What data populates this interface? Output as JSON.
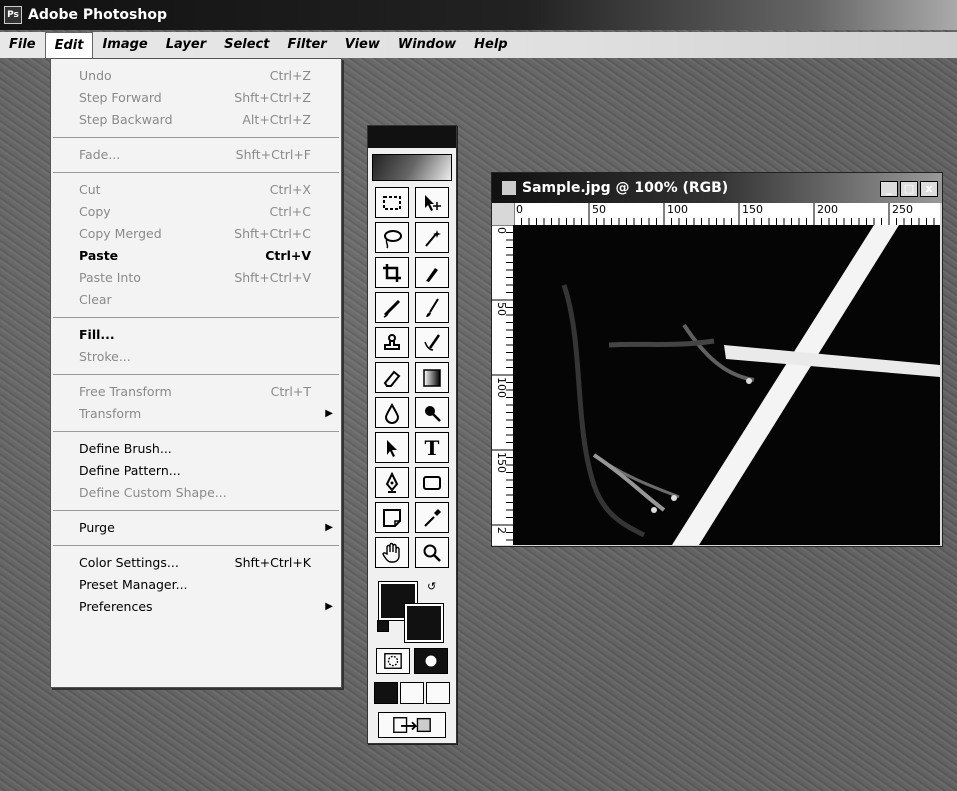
{
  "app": {
    "title": "Adobe Photoshop"
  },
  "menubar": {
    "items": [
      {
        "label": "File"
      },
      {
        "label": "Edit"
      },
      {
        "label": "Image"
      },
      {
        "label": "Layer"
      },
      {
        "label": "Select"
      },
      {
        "label": "Filter"
      },
      {
        "label": "View"
      },
      {
        "label": "Window"
      },
      {
        "label": "Help"
      }
    ],
    "active": "Edit"
  },
  "edit_menu": {
    "undo": {
      "label": "Undo",
      "shortcut": "Ctrl+Z"
    },
    "step_forward": {
      "label": "Step Forward",
      "shortcut": "Shft+Ctrl+Z"
    },
    "step_backward": {
      "label": "Step Backward",
      "shortcut": "Alt+Ctrl+Z"
    },
    "fade": {
      "label": "Fade...",
      "shortcut": "Shft+Ctrl+F"
    },
    "cut": {
      "label": "Cut",
      "shortcut": "Ctrl+X"
    },
    "copy": {
      "label": "Copy",
      "shortcut": "Ctrl+C"
    },
    "copy_merged": {
      "label": "Copy Merged",
      "shortcut": "Shft+Ctrl+C"
    },
    "paste": {
      "label": "Paste",
      "shortcut": "Ctrl+V"
    },
    "paste_into": {
      "label": "Paste Into",
      "shortcut": "Shft+Ctrl+V"
    },
    "clear": {
      "label": "Clear"
    },
    "fill": {
      "label": "Fill..."
    },
    "stroke": {
      "label": "Stroke..."
    },
    "free_transform": {
      "label": "Free Transform",
      "shortcut": "Ctrl+T"
    },
    "transform": {
      "label": "Transform"
    },
    "define_brush": {
      "label": "Define Brush..."
    },
    "define_pattern": {
      "label": "Define Pattern..."
    },
    "define_custom_shape": {
      "label": "Define Custom Shape..."
    },
    "purge": {
      "label": "Purge"
    },
    "color_settings": {
      "label": "Color Settings...",
      "shortcut": "Shft+Ctrl+K"
    },
    "preset_manager": {
      "label": "Preset Manager..."
    },
    "preferences": {
      "label": "Preferences"
    }
  },
  "toolbox": {
    "tools": [
      "rectangular-marquee-icon",
      "move-icon",
      "lasso-icon",
      "magic-wand-icon",
      "crop-icon",
      "slice-icon",
      "healing-brush-icon",
      "brush-icon",
      "clone-stamp-icon",
      "history-brush-icon",
      "eraser-icon",
      "gradient-icon",
      "blur-icon",
      "dodge-icon",
      "path-selection-icon",
      "type-icon",
      "pen-icon",
      "rectangle-shape-icon",
      "notes-icon",
      "eyedropper-icon",
      "hand-icon",
      "zoom-icon"
    ],
    "type_tool_glyph": "T",
    "colors": {
      "foreground": "#111111",
      "background": "#111111"
    }
  },
  "document": {
    "title": "Sample.jpg @ 100% (RGB)",
    "ruler_top_labels": [
      "0",
      "50",
      "100",
      "150",
      "200",
      "250"
    ],
    "ruler_left_labels": [
      "0",
      "50",
      "100",
      "150",
      "2"
    ],
    "window_buttons": {
      "minimize": "_",
      "maximize": "□",
      "close": "x"
    }
  }
}
